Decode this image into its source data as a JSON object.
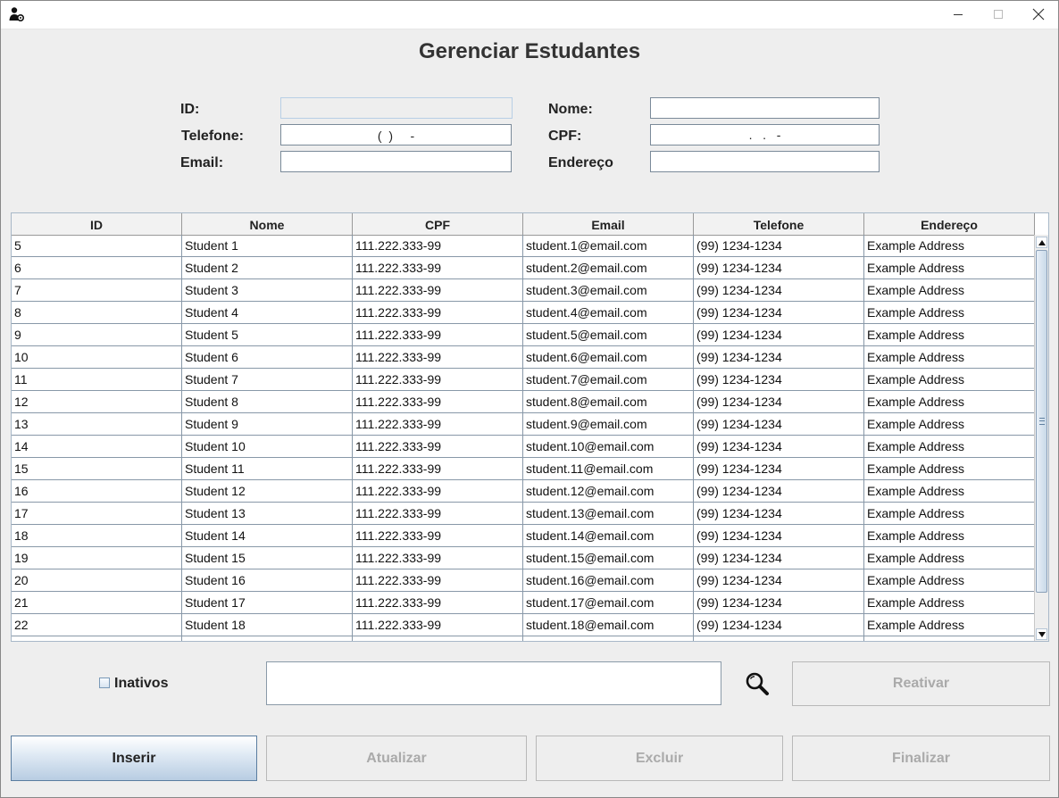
{
  "window": {
    "icon": "user-gear-icon"
  },
  "title": "Gerenciar Estudantes",
  "form": {
    "id": {
      "label": "ID:",
      "value": ""
    },
    "nome": {
      "label": "Nome:",
      "value": ""
    },
    "telefone": {
      "label": "Telefone:",
      "value": "(  )     -"
    },
    "cpf": {
      "label": "CPF:",
      "value": ".   .   -"
    },
    "email": {
      "label": "Email:",
      "value": ""
    },
    "endereco": {
      "label": "Endereço",
      "value": ""
    }
  },
  "table": {
    "columns": [
      "ID",
      "Nome",
      "CPF",
      "Email",
      "Telefone",
      "Endereço"
    ],
    "rows": [
      [
        "5",
        "Student 1",
        "111.222.333-99",
        "student.1@email.com",
        "(99) 1234-1234",
        "Example Address"
      ],
      [
        "6",
        "Student 2",
        "111.222.333-99",
        "student.2@email.com",
        "(99) 1234-1234",
        "Example Address"
      ],
      [
        "7",
        "Student 3",
        "111.222.333-99",
        "student.3@email.com",
        "(99) 1234-1234",
        "Example Address"
      ],
      [
        "8",
        "Student 4",
        "111.222.333-99",
        "student.4@email.com",
        "(99) 1234-1234",
        "Example Address"
      ],
      [
        "9",
        "Student 5",
        "111.222.333-99",
        "student.5@email.com",
        "(99) 1234-1234",
        "Example Address"
      ],
      [
        "10",
        "Student 6",
        "111.222.333-99",
        "student.6@email.com",
        "(99) 1234-1234",
        "Example Address"
      ],
      [
        "11",
        "Student 7",
        "111.222.333-99",
        "student.7@email.com",
        "(99) 1234-1234",
        "Example Address"
      ],
      [
        "12",
        "Student 8",
        "111.222.333-99",
        "student.8@email.com",
        "(99) 1234-1234",
        "Example Address"
      ],
      [
        "13",
        "Student 9",
        "111.222.333-99",
        "student.9@email.com",
        "(99) 1234-1234",
        "Example Address"
      ],
      [
        "14",
        "Student 10",
        "111.222.333-99",
        "student.10@email.com",
        "(99) 1234-1234",
        "Example Address"
      ],
      [
        "15",
        "Student 11",
        "111.222.333-99",
        "student.11@email.com",
        "(99) 1234-1234",
        "Example Address"
      ],
      [
        "16",
        "Student 12",
        "111.222.333-99",
        "student.12@email.com",
        "(99) 1234-1234",
        "Example Address"
      ],
      [
        "17",
        "Student 13",
        "111.222.333-99",
        "student.13@email.com",
        "(99) 1234-1234",
        "Example Address"
      ],
      [
        "18",
        "Student 14",
        "111.222.333-99",
        "student.14@email.com",
        "(99) 1234-1234",
        "Example Address"
      ],
      [
        "19",
        "Student 15",
        "111.222.333-99",
        "student.15@email.com",
        "(99) 1234-1234",
        "Example Address"
      ],
      [
        "20",
        "Student 16",
        "111.222.333-99",
        "student.16@email.com",
        "(99) 1234-1234",
        "Example Address"
      ],
      [
        "21",
        "Student 17",
        "111.222.333-99",
        "student.17@email.com",
        "(99) 1234-1234",
        "Example Address"
      ],
      [
        "22",
        "Student 18",
        "111.222.333-99",
        "student.18@email.com",
        "(99) 1234-1234",
        "Example Address"
      ]
    ]
  },
  "filter": {
    "inactive_label": "Inativos",
    "inactive_checked": false,
    "search_value": "",
    "search_icon": "search-icon",
    "reactivate_label": "Reativar"
  },
  "actions": {
    "insert": "Inserir",
    "update": "Atualizar",
    "delete": "Excluir",
    "finish": "Finalizar"
  },
  "colors": {
    "background": "#eeeeee",
    "primary_button_top": "#ffffff",
    "primary_button_bottom": "#b8cde2",
    "disabled_text": "#aaaaaa",
    "grid_line": "#8898a8"
  }
}
